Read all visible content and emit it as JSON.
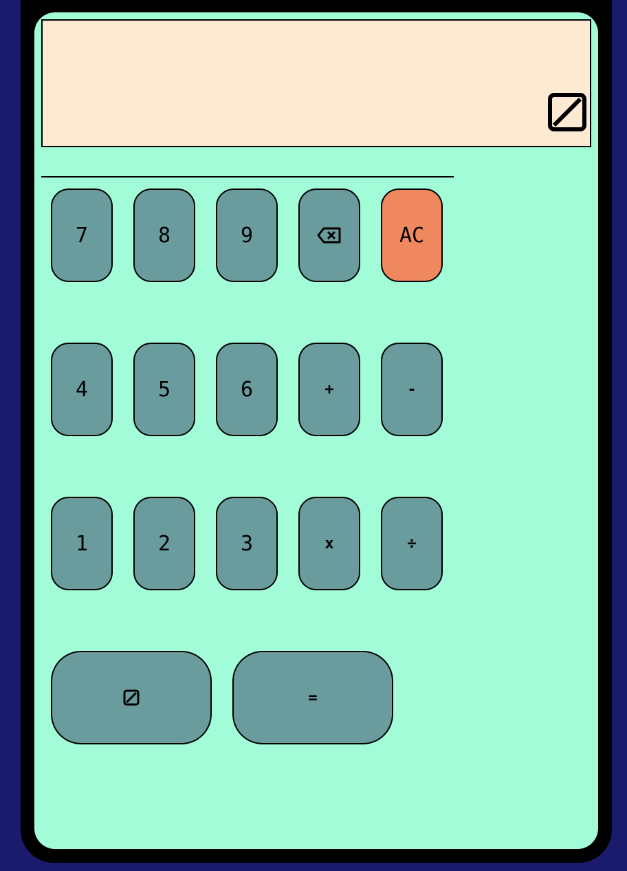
{
  "display": {
    "value": "",
    "icon": "zero-slash-icon"
  },
  "keypad": {
    "row1": [
      {
        "label": "7"
      },
      {
        "label": "8"
      },
      {
        "label": "9"
      },
      {
        "label": "",
        "icon": "backspace-icon"
      },
      {
        "label": "AC"
      }
    ],
    "row2": [
      {
        "label": "4"
      },
      {
        "label": "5"
      },
      {
        "label": "6"
      },
      {
        "label": "+"
      },
      {
        "label": "-"
      }
    ],
    "row3": [
      {
        "label": "1"
      },
      {
        "label": "2"
      },
      {
        "label": "3"
      },
      {
        "label": "x"
      },
      {
        "label": "÷"
      }
    ],
    "row4": [
      {
        "label": "",
        "icon": "zero-slash-icon"
      },
      {
        "label": "="
      }
    ]
  },
  "colors": {
    "background": "#1b1b6e",
    "screen": "#a2fcd8",
    "display": "#fdead2",
    "key": "#6b9c9d",
    "clear_key": "#ef875f"
  }
}
